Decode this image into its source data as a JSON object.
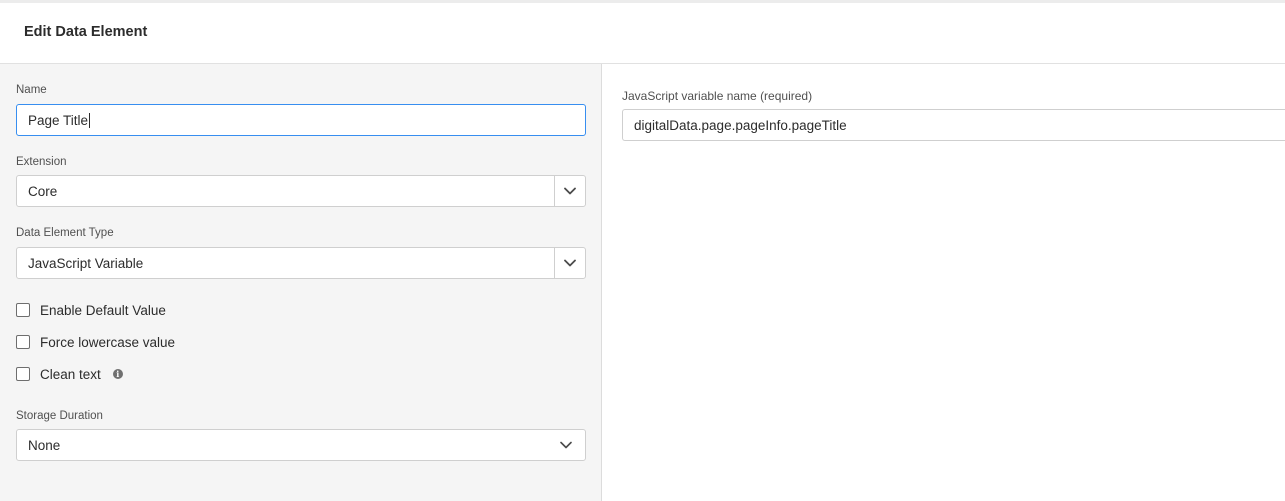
{
  "header": {
    "title": "Edit Data Element"
  },
  "form": {
    "name": {
      "label": "Name",
      "value": "Page Title"
    },
    "extension": {
      "label": "Extension",
      "value": "Core"
    },
    "type": {
      "label": "Data Element Type",
      "value": "JavaScript Variable"
    },
    "checkboxes": [
      {
        "label": "Enable Default Value",
        "checked": false
      },
      {
        "label": "Force lowercase value",
        "checked": false
      },
      {
        "label": "Clean text",
        "checked": false,
        "info_icon": "info-icon"
      }
    ],
    "storage": {
      "label": "Storage Duration",
      "value": "None"
    }
  },
  "settings": {
    "js_var": {
      "label": "JavaScript variable name (required)",
      "value": "digitalData.page.pageInfo.pageTitle"
    }
  },
  "colors": {
    "focus": "#378ef0",
    "panel": "#f5f5f5",
    "border": "#cfcfcf"
  }
}
